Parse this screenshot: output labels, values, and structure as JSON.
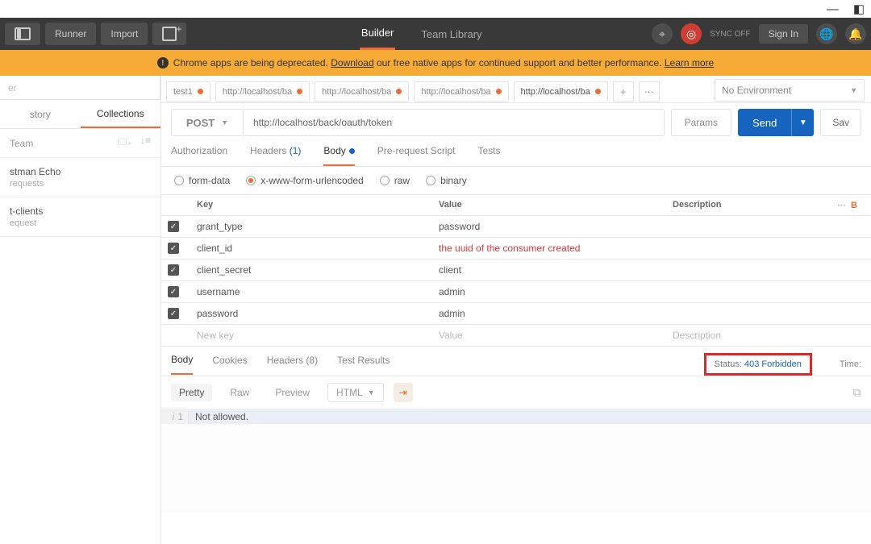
{
  "titlebar": {
    "minimize": "—",
    "expand": "◧"
  },
  "topbar": {
    "runner": "Runner",
    "import": "Import",
    "builder": "Builder",
    "teamlib": "Team Library",
    "sync": "SYNC OFF",
    "signin": "Sign In"
  },
  "banner": {
    "pre": "Chrome apps are being deprecated. ",
    "download": "Download",
    "mid": " our free native apps for continued support and better performance. ",
    "learn": "Learn more"
  },
  "sidebar": {
    "filter_ph": "er",
    "history": "story",
    "collections": "Collections",
    "team": "Team",
    "items": [
      {
        "name": "stman Echo",
        "sub": "requests"
      },
      {
        "name": "t-clients",
        "sub": "equest"
      }
    ]
  },
  "tabs": [
    {
      "label": "test1",
      "dirty": true,
      "active": false
    },
    {
      "label": "http://localhost/ba",
      "dirty": true,
      "active": false
    },
    {
      "label": "http://localhost/ba",
      "dirty": true,
      "active": false
    },
    {
      "label": "http://localhost/ba",
      "dirty": true,
      "active": false
    },
    {
      "label": "http://localhost/ba",
      "dirty": true,
      "active": true
    }
  ],
  "env": "No Environment",
  "request": {
    "method": "POST",
    "url": "http://localhost/back/oauth/token",
    "params": "Params",
    "send": "Send",
    "save": "Sav"
  },
  "subtabs": {
    "auth": "Authorization",
    "headers": "Headers ",
    "hcount": "(1)",
    "body": "Body",
    "prs": "Pre-request Script",
    "tests": "Tests"
  },
  "bodytypes": {
    "formdata": "form-data",
    "xwww": "x-www-form-urlencoded",
    "raw": "raw",
    "binary": "binary"
  },
  "kv": {
    "head": {
      "key": "Key",
      "value": "Value",
      "desc": "Description",
      "bulk": "B"
    },
    "rows": [
      {
        "k": "grant_type",
        "v": "password",
        "red": false
      },
      {
        "k": "client_id",
        "v": "the uuid     of the consumer created",
        "red": true
      },
      {
        "k": "client_secret",
        "v": "client",
        "red": false
      },
      {
        "k": "username",
        "v": "admin",
        "red": false
      },
      {
        "k": "password",
        "v": "admin",
        "red": false
      }
    ],
    "ph": {
      "k": "New key",
      "v": "Value",
      "d": "Description"
    }
  },
  "resp": {
    "body": "Body",
    "cookies": "Cookies",
    "headers": "Headers ",
    "hcount": "(8)",
    "tests": "Test Results",
    "statuslabel": "Status: ",
    "status": "403 Forbidden",
    "time": "Time:"
  },
  "view": {
    "pretty": "Pretty",
    "raw": "Raw",
    "preview": "Preview",
    "fmt": "HTML"
  },
  "code": {
    "line": "1",
    "text": "Not allowed."
  }
}
